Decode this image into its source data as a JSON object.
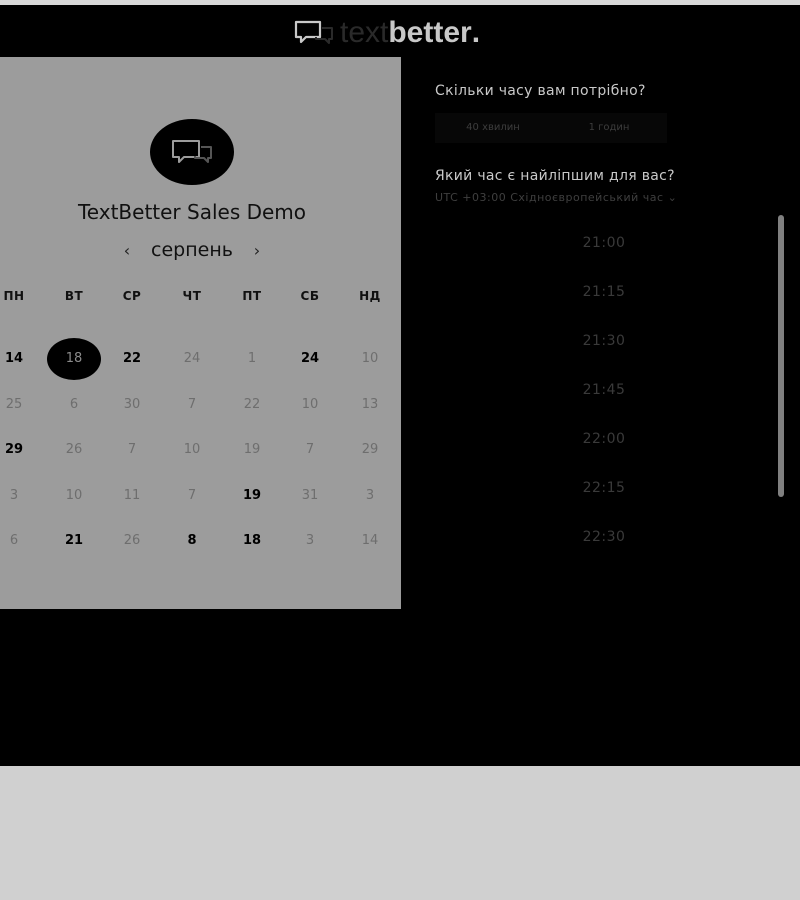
{
  "header": {
    "logo_light": "text",
    "logo_bold": "better",
    "logo_dot": ".",
    "logo_icon": "chat-bubbles-icon"
  },
  "calendar": {
    "title": "TextBetter Sales Demo",
    "month": "серпень",
    "prev_arrow": "‹",
    "next_arrow": "›",
    "weekdays": [
      "ПН",
      "ВТ",
      "СР",
      "ЧТ",
      "ПТ",
      "СБ",
      "НД"
    ],
    "weeks": [
      [
        {
          "d": "14",
          "s": "avail"
        },
        {
          "d": "18",
          "s": "selected"
        },
        {
          "d": "22",
          "s": "avail"
        },
        {
          "d": "24",
          "s": "dim"
        },
        {
          "d": "1",
          "s": "dim"
        },
        {
          "d": "24",
          "s": "avail"
        },
        {
          "d": "10",
          "s": "dim"
        }
      ],
      [
        {
          "d": "25",
          "s": "dim"
        },
        {
          "d": "6",
          "s": "dim"
        },
        {
          "d": "30",
          "s": "dim"
        },
        {
          "d": "7",
          "s": "dim"
        },
        {
          "d": "22",
          "s": "dim"
        },
        {
          "d": "10",
          "s": "dim"
        },
        {
          "d": "13",
          "s": "dim"
        }
      ],
      [
        {
          "d": "29",
          "s": "avail"
        },
        {
          "d": "26",
          "s": "dim"
        },
        {
          "d": "7",
          "s": "dim"
        },
        {
          "d": "10",
          "s": "dim"
        },
        {
          "d": "19",
          "s": "dim"
        },
        {
          "d": "7",
          "s": "dim"
        },
        {
          "d": "29",
          "s": "dim"
        }
      ],
      [
        {
          "d": "3",
          "s": "dim"
        },
        {
          "d": "10",
          "s": "dim"
        },
        {
          "d": "11",
          "s": "dim"
        },
        {
          "d": "7",
          "s": "dim"
        },
        {
          "d": "19",
          "s": "avail"
        },
        {
          "d": "31",
          "s": "dim"
        },
        {
          "d": "3",
          "s": "dim"
        }
      ],
      [
        {
          "d": "6",
          "s": "dim"
        },
        {
          "d": "21",
          "s": "avail"
        },
        {
          "d": "26",
          "s": "dim"
        },
        {
          "d": "8",
          "s": "avail"
        },
        {
          "d": "18",
          "s": "avail"
        },
        {
          "d": "3",
          "s": "dim"
        },
        {
          "d": "14",
          "s": "dim"
        }
      ]
    ]
  },
  "booking": {
    "duration_question": "Скільки часу вам потрібно?",
    "durations": [
      "40 хвилин",
      "1 годин"
    ],
    "time_question": "Який час є найліпшим для вас?",
    "timezone": "UTC +03:00 Східноєвропейський час",
    "timezone_caret": "⌄",
    "slots": [
      "21:00",
      "21:15",
      "21:30",
      "21:45",
      "22:00",
      "22:15",
      "22:30"
    ]
  },
  "colors": {
    "background": "#000000",
    "card": "#9c9c9c",
    "page_bottom": "#d0d0d0"
  }
}
